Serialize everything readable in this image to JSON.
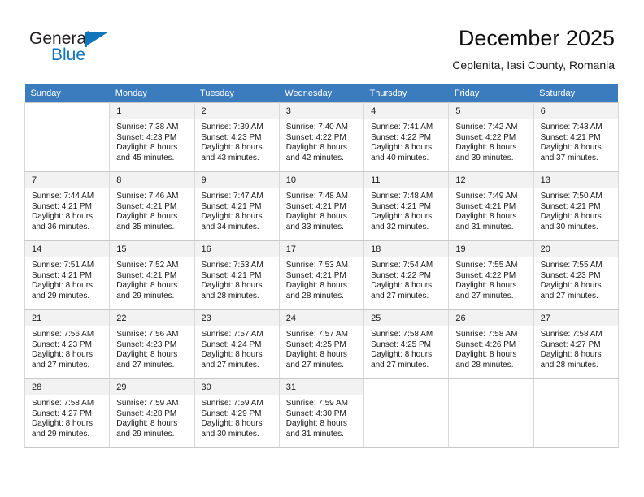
{
  "brand": {
    "name_part1": "General",
    "name_part2": "Blue",
    "accent_color": "#1175bc"
  },
  "header": {
    "title": "December 2025",
    "subtitle": "Ceplenita, Iasi County, Romania"
  },
  "calendar": {
    "header_bg": "#3a7cbe",
    "weekdays": [
      "Sunday",
      "Monday",
      "Tuesday",
      "Wednesday",
      "Thursday",
      "Friday",
      "Saturday"
    ],
    "weeks": [
      [
        {
          "day": "",
          "sunrise": "",
          "sunset": "",
          "daylight1": "",
          "daylight2": ""
        },
        {
          "day": "1",
          "sunrise": "Sunrise: 7:38 AM",
          "sunset": "Sunset: 4:23 PM",
          "daylight1": "Daylight: 8 hours",
          "daylight2": "and 45 minutes."
        },
        {
          "day": "2",
          "sunrise": "Sunrise: 7:39 AM",
          "sunset": "Sunset: 4:23 PM",
          "daylight1": "Daylight: 8 hours",
          "daylight2": "and 43 minutes."
        },
        {
          "day": "3",
          "sunrise": "Sunrise: 7:40 AM",
          "sunset": "Sunset: 4:22 PM",
          "daylight1": "Daylight: 8 hours",
          "daylight2": "and 42 minutes."
        },
        {
          "day": "4",
          "sunrise": "Sunrise: 7:41 AM",
          "sunset": "Sunset: 4:22 PM",
          "daylight1": "Daylight: 8 hours",
          "daylight2": "and 40 minutes."
        },
        {
          "day": "5",
          "sunrise": "Sunrise: 7:42 AM",
          "sunset": "Sunset: 4:22 PM",
          "daylight1": "Daylight: 8 hours",
          "daylight2": "and 39 minutes."
        },
        {
          "day": "6",
          "sunrise": "Sunrise: 7:43 AM",
          "sunset": "Sunset: 4:21 PM",
          "daylight1": "Daylight: 8 hours",
          "daylight2": "and 37 minutes."
        }
      ],
      [
        {
          "day": "7",
          "sunrise": "Sunrise: 7:44 AM",
          "sunset": "Sunset: 4:21 PM",
          "daylight1": "Daylight: 8 hours",
          "daylight2": "and 36 minutes."
        },
        {
          "day": "8",
          "sunrise": "Sunrise: 7:46 AM",
          "sunset": "Sunset: 4:21 PM",
          "daylight1": "Daylight: 8 hours",
          "daylight2": "and 35 minutes."
        },
        {
          "day": "9",
          "sunrise": "Sunrise: 7:47 AM",
          "sunset": "Sunset: 4:21 PM",
          "daylight1": "Daylight: 8 hours",
          "daylight2": "and 34 minutes."
        },
        {
          "day": "10",
          "sunrise": "Sunrise: 7:48 AM",
          "sunset": "Sunset: 4:21 PM",
          "daylight1": "Daylight: 8 hours",
          "daylight2": "and 33 minutes."
        },
        {
          "day": "11",
          "sunrise": "Sunrise: 7:48 AM",
          "sunset": "Sunset: 4:21 PM",
          "daylight1": "Daylight: 8 hours",
          "daylight2": "and 32 minutes."
        },
        {
          "day": "12",
          "sunrise": "Sunrise: 7:49 AM",
          "sunset": "Sunset: 4:21 PM",
          "daylight1": "Daylight: 8 hours",
          "daylight2": "and 31 minutes."
        },
        {
          "day": "13",
          "sunrise": "Sunrise: 7:50 AM",
          "sunset": "Sunset: 4:21 PM",
          "daylight1": "Daylight: 8 hours",
          "daylight2": "and 30 minutes."
        }
      ],
      [
        {
          "day": "14",
          "sunrise": "Sunrise: 7:51 AM",
          "sunset": "Sunset: 4:21 PM",
          "daylight1": "Daylight: 8 hours",
          "daylight2": "and 29 minutes."
        },
        {
          "day": "15",
          "sunrise": "Sunrise: 7:52 AM",
          "sunset": "Sunset: 4:21 PM",
          "daylight1": "Daylight: 8 hours",
          "daylight2": "and 29 minutes."
        },
        {
          "day": "16",
          "sunrise": "Sunrise: 7:53 AM",
          "sunset": "Sunset: 4:21 PM",
          "daylight1": "Daylight: 8 hours",
          "daylight2": "and 28 minutes."
        },
        {
          "day": "17",
          "sunrise": "Sunrise: 7:53 AM",
          "sunset": "Sunset: 4:21 PM",
          "daylight1": "Daylight: 8 hours",
          "daylight2": "and 28 minutes."
        },
        {
          "day": "18",
          "sunrise": "Sunrise: 7:54 AM",
          "sunset": "Sunset: 4:22 PM",
          "daylight1": "Daylight: 8 hours",
          "daylight2": "and 27 minutes."
        },
        {
          "day": "19",
          "sunrise": "Sunrise: 7:55 AM",
          "sunset": "Sunset: 4:22 PM",
          "daylight1": "Daylight: 8 hours",
          "daylight2": "and 27 minutes."
        },
        {
          "day": "20",
          "sunrise": "Sunrise: 7:55 AM",
          "sunset": "Sunset: 4:23 PM",
          "daylight1": "Daylight: 8 hours",
          "daylight2": "and 27 minutes."
        }
      ],
      [
        {
          "day": "21",
          "sunrise": "Sunrise: 7:56 AM",
          "sunset": "Sunset: 4:23 PM",
          "daylight1": "Daylight: 8 hours",
          "daylight2": "and 27 minutes."
        },
        {
          "day": "22",
          "sunrise": "Sunrise: 7:56 AM",
          "sunset": "Sunset: 4:23 PM",
          "daylight1": "Daylight: 8 hours",
          "daylight2": "and 27 minutes."
        },
        {
          "day": "23",
          "sunrise": "Sunrise: 7:57 AM",
          "sunset": "Sunset: 4:24 PM",
          "daylight1": "Daylight: 8 hours",
          "daylight2": "and 27 minutes."
        },
        {
          "day": "24",
          "sunrise": "Sunrise: 7:57 AM",
          "sunset": "Sunset: 4:25 PM",
          "daylight1": "Daylight: 8 hours",
          "daylight2": "and 27 minutes."
        },
        {
          "day": "25",
          "sunrise": "Sunrise: 7:58 AM",
          "sunset": "Sunset: 4:25 PM",
          "daylight1": "Daylight: 8 hours",
          "daylight2": "and 27 minutes."
        },
        {
          "day": "26",
          "sunrise": "Sunrise: 7:58 AM",
          "sunset": "Sunset: 4:26 PM",
          "daylight1": "Daylight: 8 hours",
          "daylight2": "and 28 minutes."
        },
        {
          "day": "27",
          "sunrise": "Sunrise: 7:58 AM",
          "sunset": "Sunset: 4:27 PM",
          "daylight1": "Daylight: 8 hours",
          "daylight2": "and 28 minutes."
        }
      ],
      [
        {
          "day": "28",
          "sunrise": "Sunrise: 7:58 AM",
          "sunset": "Sunset: 4:27 PM",
          "daylight1": "Daylight: 8 hours",
          "daylight2": "and 29 minutes."
        },
        {
          "day": "29",
          "sunrise": "Sunrise: 7:59 AM",
          "sunset": "Sunset: 4:28 PM",
          "daylight1": "Daylight: 8 hours",
          "daylight2": "and 29 minutes."
        },
        {
          "day": "30",
          "sunrise": "Sunrise: 7:59 AM",
          "sunset": "Sunset: 4:29 PM",
          "daylight1": "Daylight: 8 hours",
          "daylight2": "and 30 minutes."
        },
        {
          "day": "31",
          "sunrise": "Sunrise: 7:59 AM",
          "sunset": "Sunset: 4:30 PM",
          "daylight1": "Daylight: 8 hours",
          "daylight2": "and 31 minutes."
        },
        {
          "day": "",
          "sunrise": "",
          "sunset": "",
          "daylight1": "",
          "daylight2": ""
        },
        {
          "day": "",
          "sunrise": "",
          "sunset": "",
          "daylight1": "",
          "daylight2": ""
        },
        {
          "day": "",
          "sunrise": "",
          "sunset": "",
          "daylight1": "",
          "daylight2": ""
        }
      ]
    ]
  }
}
